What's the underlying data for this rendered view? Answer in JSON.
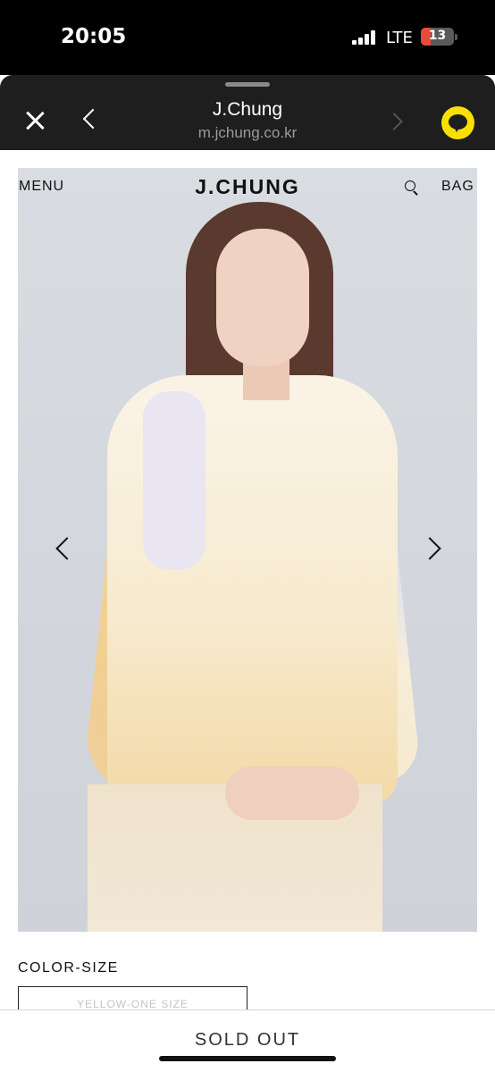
{
  "status_bar": {
    "time": "20:05",
    "network": "LTE",
    "battery_level": "13",
    "battery_fraction": 0.13,
    "battery_color": "#e84a3c"
  },
  "browser": {
    "site_title": "J.Chung",
    "site_url": "m.jchung.co.kr",
    "close_icon": "close-icon",
    "back_icon": "chevron-left-icon",
    "forward_icon": "chevron-right-icon",
    "talk_icon": "kakaotalk-icon",
    "talk_color": "#f9e000"
  },
  "site_header": {
    "menu_label": "MENU",
    "brand": "J.CHUNG",
    "search_icon": "search-icon",
    "bag_label": "BAG"
  },
  "product": {
    "option_label": "COLOR-SIZE",
    "option_value": "YELLOW-ONE SIZE",
    "buy_button": "SOLD OUT"
  }
}
